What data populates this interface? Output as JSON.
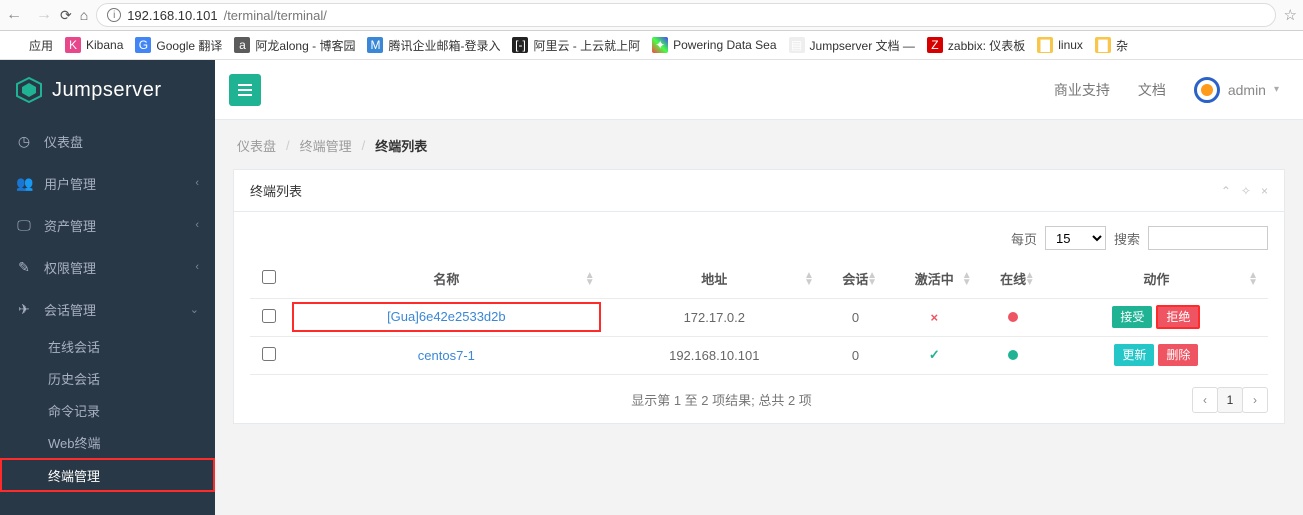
{
  "browser": {
    "url_host": "192.168.10.101",
    "url_path": "/terminal/terminal/"
  },
  "bookmarks": {
    "apps": "应用",
    "items": [
      "Kibana",
      "Google 翻译",
      "阿龙along - 博客园",
      "腾讯企业邮箱-登录入",
      "阿里云 - 上云就上阿",
      "Powering Data Sea",
      "Jumpserver 文档 —",
      "zabbix: 仪表板",
      "linux",
      "杂"
    ]
  },
  "brand": "Jumpserver",
  "sidebar": {
    "items": [
      {
        "icon": "◐",
        "label": "仪表盘"
      },
      {
        "icon": "👥",
        "label": "用户管理"
      },
      {
        "icon": "🖵",
        "label": "资产管理"
      },
      {
        "icon": "✎",
        "label": "权限管理"
      },
      {
        "icon": "✈",
        "label": "会话管理"
      }
    ],
    "sub": [
      "在线会话",
      "历史会话",
      "命令记录",
      "Web终端",
      "终端管理"
    ]
  },
  "topbar": {
    "support": "商业支持",
    "docs": "文档",
    "user": "admin"
  },
  "breadcrumb": {
    "a": "仪表盘",
    "b": "终端管理",
    "c": "终端列表"
  },
  "panel": {
    "title": "终端列表"
  },
  "controls": {
    "per_page_label": "每页",
    "per_page_value": "15",
    "search_label": "搜索"
  },
  "columns": {
    "name": "名称",
    "addr": "地址",
    "session": "会话",
    "activating": "激活中",
    "online": "在线",
    "action": "动作"
  },
  "rows": [
    {
      "name": "[Gua]6e42e2533d2b",
      "addr": "172.17.0.2",
      "session": "0",
      "active": "x",
      "online": "red",
      "hl": true,
      "btns": [
        "接受",
        "拒绝"
      ]
    },
    {
      "name": "centos7-1",
      "addr": "192.168.10.101",
      "session": "0",
      "active": "check",
      "online": "green",
      "hl": false,
      "btns": [
        "更新",
        "删除"
      ]
    }
  ],
  "footer": {
    "info": "显示第 1 至 2 项结果; 总共 2 项",
    "page": "1"
  }
}
